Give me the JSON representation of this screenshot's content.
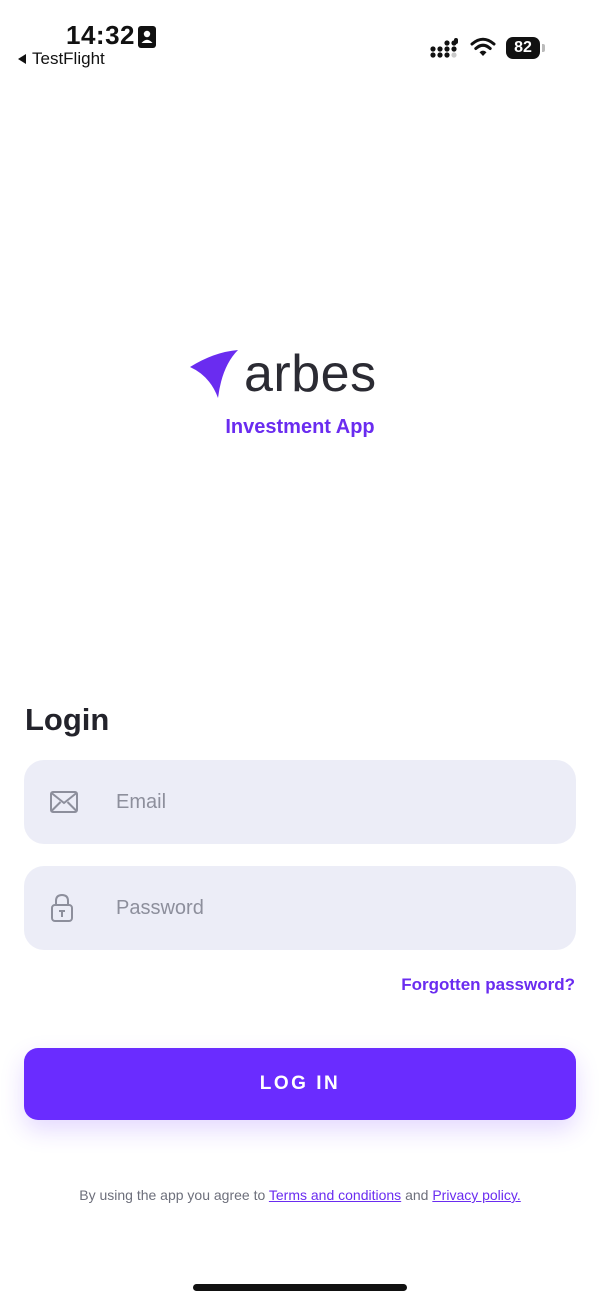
{
  "status_bar": {
    "time": "14:32",
    "back_app": "TestFlight",
    "battery": "82",
    "icons": [
      "id-card-icon",
      "signal-icon",
      "wifi-icon",
      "battery-icon"
    ]
  },
  "brand": {
    "name": "arbes",
    "tagline": "Investment App",
    "accent_color": "#6a2cf0",
    "logo_icon": "arrow-wing-logo-icon"
  },
  "login": {
    "title": "Login",
    "email": {
      "placeholder": "Email",
      "value": "",
      "icon": "envelope-icon"
    },
    "password": {
      "placeholder": "Password",
      "value": "",
      "icon": "lock-icon"
    },
    "forgot_label": "Forgotten password?",
    "button_label": "LOG IN",
    "button_color": "#6a2cff"
  },
  "legal": {
    "prefix": "By using the app you agree to ",
    "terms": "Terms and conditions",
    "and": " and ",
    "privacy": "Privacy policy."
  }
}
